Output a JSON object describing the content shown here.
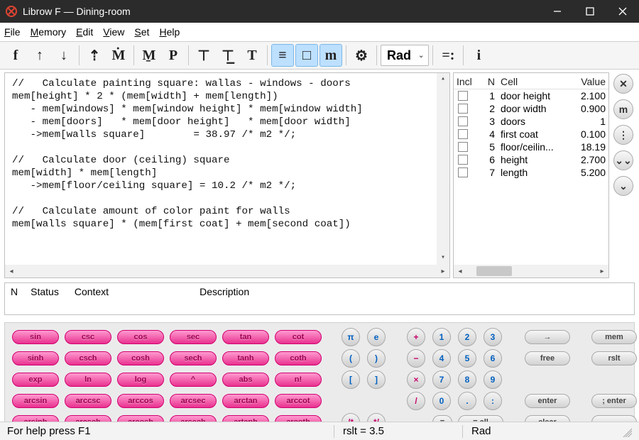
{
  "window": {
    "title": "Librow F — Dining-room"
  },
  "menu": {
    "file": "File",
    "memory": "Memory",
    "edit": "Edit",
    "view": "View",
    "set": "Set",
    "help": "Help"
  },
  "toolbar": {
    "angle_mode": "Rad",
    "glyphs": [
      "f",
      "↑",
      "↓",
      "⇡",
      "Ṁ",
      "M̱",
      "P",
      "⊤",
      "⊤̲",
      "T",
      "≡",
      "□",
      "m",
      "⚙"
    ],
    "right_glyphs": [
      "=:",
      "i"
    ],
    "selected_group_start": 10,
    "selected_group_end": 12
  },
  "editor_lines": [
    "//   Calculate painting square: wallas - windows - doors",
    "mem[height] * 2 * (mem[width] + mem[length])",
    "   - mem[windows] * mem[window height] * mem[window width]",
    "   - mem[doors]   * mem[door height]   * mem[door width]",
    "   ->mem[walls square]        = 38.97 /* m2 */;",
    "",
    "//   Calculate door (ceiling) square",
    "mem[width] * mem[length]",
    "   ->mem[floor/ceiling square] = 10.2 /* m2 */;",
    "",
    "//   Calculate amount of color paint for walls",
    "mem[walls square] * (mem[first coat] + mem[second coat])"
  ],
  "mem_headers": {
    "incl": "Incl",
    "n": "N",
    "cell": "Cell",
    "value": "Value"
  },
  "mem_rows": [
    {
      "n": 1,
      "cell": "door height",
      "value": "2.100"
    },
    {
      "n": 2,
      "cell": "door width",
      "value": "0.900"
    },
    {
      "n": 3,
      "cell": "doors",
      "value": "1"
    },
    {
      "n": 4,
      "cell": "first coat",
      "value": "0.100"
    },
    {
      "n": 5,
      "cell": "floor/ceilin...",
      "value": "18.19"
    },
    {
      "n": 6,
      "cell": "height",
      "value": "2.700"
    },
    {
      "n": 7,
      "cell": "length",
      "value": "5.200"
    }
  ],
  "side_buttons": [
    "✕",
    "m",
    "⋮",
    "⌄⌄",
    "⌄"
  ],
  "msg_headers": {
    "n": "N",
    "status": "Status",
    "context": "Context",
    "description": "Description"
  },
  "keypad": {
    "fn_rows": [
      [
        "sin",
        "csc",
        "cos",
        "sec",
        "tan",
        "cot"
      ],
      [
        "sinh",
        "csch",
        "cosh",
        "sech",
        "tanh",
        "coth"
      ],
      [
        "exp",
        "ln",
        "log",
        "^",
        "abs",
        "n!"
      ],
      [
        "arcsin",
        "arccsc",
        "arccos",
        "arcsec",
        "arctan",
        "arccot"
      ],
      [
        "arsinh",
        "arcsch",
        "arcosh",
        "arsech",
        "artanh",
        "arcoth"
      ]
    ],
    "col_sym": [
      [
        "π",
        "e"
      ],
      [
        "(",
        ")"
      ],
      [
        "[",
        "]"
      ],
      [
        "",
        ""
      ],
      [
        "/*",
        "*/"
      ]
    ],
    "col_op": [
      "+",
      "−",
      "×",
      "/",
      ""
    ],
    "col_num": [
      [
        "1",
        "2",
        "3"
      ],
      [
        "4",
        "5",
        "6"
      ],
      [
        "7",
        "8",
        "9"
      ],
      [
        "0",
        ".",
        ":"
      ],
      [
        "",
        "",
        ""
      ]
    ],
    "col_gray1": [
      "→",
      "free",
      "",
      "enter",
      "clear"
    ],
    "col_gray2": [
      "mem",
      "rslt",
      "",
      "; enter",
      "←"
    ],
    "eq_row": {
      "eq": "=",
      "eq_all": "= all"
    }
  },
  "status": {
    "help": "For help press F1",
    "result": "rslt = 3.5",
    "mode": "Rad"
  }
}
